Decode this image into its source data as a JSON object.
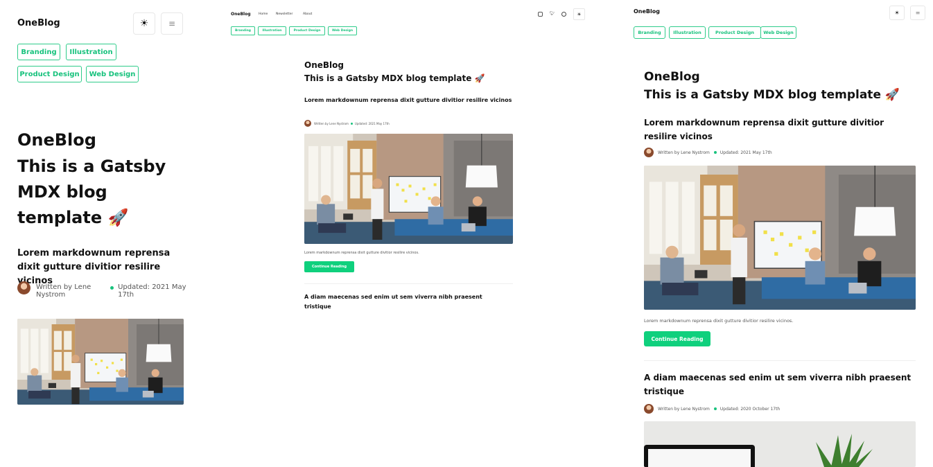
{
  "brand": "OneBlog",
  "hero": {
    "title": "OneBlog",
    "subtitle": "This is a Gatsby MDX blog template 🚀"
  },
  "nav": {
    "links": [
      "Home",
      "Newsletter",
      "About"
    ]
  },
  "icons": {
    "theme": "sun-icon",
    "menu": "hamburger-menu-icon",
    "social": [
      "instagram-icon",
      "twitter-icon",
      "github-icon"
    ]
  },
  "tags": [
    "Branding",
    "Illustration",
    "Product Design",
    "Web Design"
  ],
  "posts": [
    {
      "title": "Lorem markdownum reprensa dixit gutture divitior resilire vicinos",
      "author": "Written by Lene Nystrom",
      "updated": "Updated: 2021 May 17th",
      "excerpt": "Lorem markdownum reprensa dixit gutture divitior resilire vicinos.",
      "cta": "Continue Reading"
    },
    {
      "title": "A diam maecenas sed enim ut sem viverra nibh praesent tristique",
      "author": "Written by Lene Nystrom",
      "updated": "Updated: 2020 October 17th"
    }
  ],
  "colors": {
    "accent": "#0fd07d",
    "tag_border": "#2ecc8a",
    "text": "#111111",
    "muted": "#555555"
  }
}
